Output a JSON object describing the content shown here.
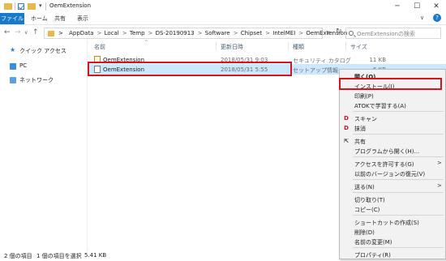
{
  "window": {
    "title": "OemExtension",
    "min": "─",
    "max": "☐",
    "close": "✕"
  },
  "ribbon": {
    "file": "ファイル",
    "home": "ホーム",
    "share": "共有",
    "view": "表示",
    "expand": "∨",
    "help": "?"
  },
  "nav": {
    "back": "←",
    "forward": "→",
    "recent": "∨",
    "up": "↑",
    "refresh": "↻",
    "dropdown": "∨"
  },
  "address": {
    "crumbs": [
      "AppData",
      "Local",
      "Temp",
      "DS-20190913",
      "Software",
      "Chipset",
      "IntelMEI",
      "OemExtension"
    ],
    "separator": ">"
  },
  "search": {
    "placeholder": "OemExtensionの検索"
  },
  "navpane": {
    "quick_access": "クイック アクセス",
    "pc": "PC",
    "network": "ネットワーク"
  },
  "columns": {
    "name": "名前",
    "date": "更新日時",
    "type": "種類",
    "size": "サイズ",
    "sort": "^"
  },
  "files": [
    {
      "name": "OemExtension",
      "date": "2018/05/31 9:03",
      "type": "セキュリティ カタログ",
      "size": "11 KB"
    },
    {
      "name": "OemExtension",
      "date": "2018/05/31 5:55",
      "type": "セットアップ情報",
      "size": "6 KB"
    }
  ],
  "status": {
    "count": "2 個の項目",
    "selected": "1 個の項目を選択",
    "size": "5.41 KB"
  },
  "context_menu": {
    "open": "開く(O)",
    "install": "インストール(I)",
    "print": "印刷(P)",
    "atok": "ATOKで学習する(A)",
    "scan": "スキャン",
    "erase": "抹消",
    "share": "共有",
    "open_with": "プログラムから開く(H)...",
    "give_access": "アクセスを許可する(G)",
    "restore": "以前のバージョンの復元(V)",
    "send_to": "送る(N)",
    "cut": "切り取り(T)",
    "copy": "コピー(C)",
    "create_shortcut": "ショートカットの作成(S)",
    "delete": "削除(D)",
    "rename": "名前の変更(M)",
    "properties": "プロパティ(R)",
    "arrow": ">"
  }
}
